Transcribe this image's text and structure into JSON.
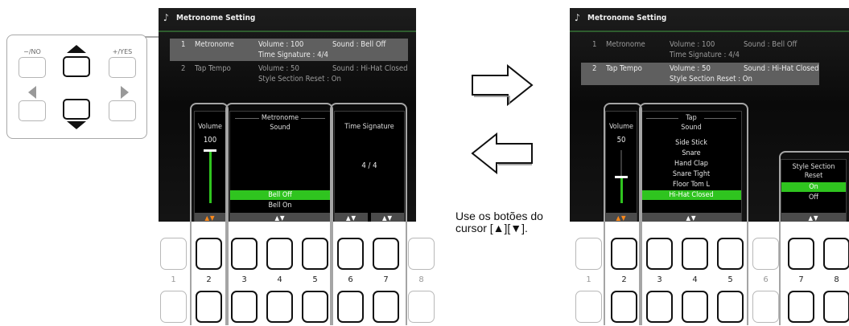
{
  "pad": {
    "no_label": "−/NO",
    "yes_label": "+/YES"
  },
  "left_screen": {
    "title": "Metronome Setting",
    "rows": [
      {
        "num": "1",
        "name": "Metronome",
        "c1": "Volume : 100",
        "c2": "Sound : Bell Off",
        "c3": "Time Signature :   4/4"
      },
      {
        "num": "2",
        "name": "Tap Tempo",
        "c1": "Volume : 50",
        "c2": "Sound : Hi-Hat Closed",
        "c3": "Style Section Reset : On"
      }
    ],
    "volume_header": "Volume",
    "volume_value": "100",
    "group_label": "Metronome",
    "sound_header": "Sound",
    "sound_options": [
      "Bell Off",
      "Bell On"
    ],
    "sound_selected": "Bell Off",
    "timesig_header": "Time Signature",
    "timesig_value": "4  /  4",
    "volume_level": 1.0
  },
  "right_screen": {
    "title": "Metronome Setting",
    "rows": [
      {
        "num": "1",
        "name": "Metronome",
        "c1": "Volume : 100",
        "c2": "Sound : Bell Off",
        "c3": "Time Signature :   4/4"
      },
      {
        "num": "2",
        "name": "Tap Tempo",
        "c1": "Volume : 50",
        "c2": "Sound : Hi-Hat Closed",
        "c3": "Style Section Reset : On"
      }
    ],
    "volume_header": "Volume",
    "volume_value": "50",
    "group_label": "Tap",
    "sound_header": "Sound",
    "sound_options": [
      "Side Stick",
      "Snare",
      "Hand Clap",
      "Snare Tight",
      "Floor Tom L",
      "Hi-Hat Closed"
    ],
    "sound_selected": "Hi-Hat Closed",
    "reset_header_1": "Style Section",
    "reset_header_2": "Reset",
    "reset_options": [
      "On",
      "Off"
    ],
    "reset_selected": "On",
    "volume_level": 0.5
  },
  "arrows": {
    "updown": "▲▼"
  },
  "button_numbers": [
    "1",
    "2",
    "3",
    "4",
    "5",
    "6",
    "7",
    "8"
  ],
  "caption": "Use os botões do cursor [▲][▼]."
}
